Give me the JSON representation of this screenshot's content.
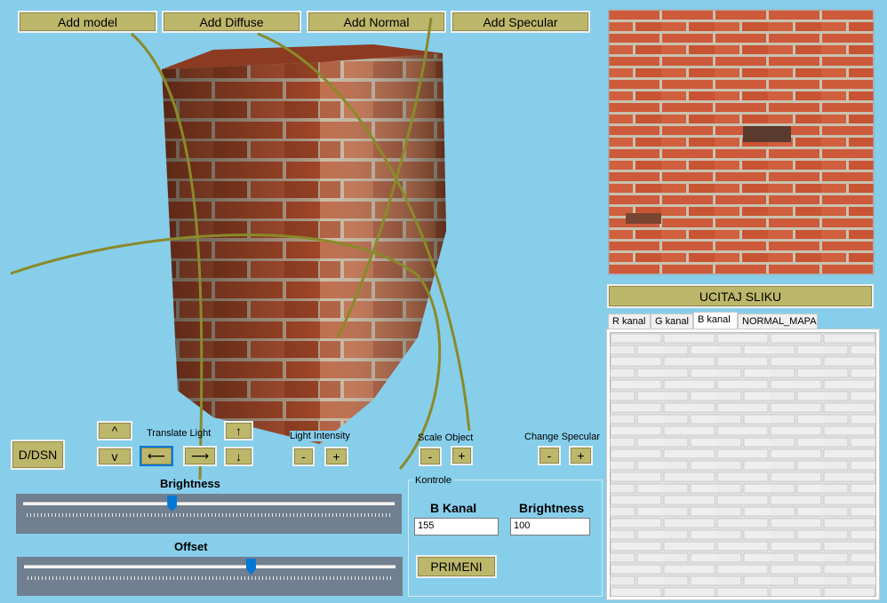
{
  "toolbar": {
    "add_model": "Add model",
    "add_diffuse": "Add Diffuse",
    "add_normal": "Add Normal",
    "add_specular": "Add Specular"
  },
  "controls": {
    "dds_button": "D/DSN",
    "translate_label": "Translate Light",
    "up_caret": "^",
    "down_caret": "v",
    "arrow_left": "⟵",
    "arrow_right": "⟶",
    "arrow_up": "↑",
    "arrow_down": "↓",
    "light_intensity_label": "Light Intensity",
    "scale_object_label": "Scale Object",
    "change_specular_label": "Change Specular",
    "minus": "-",
    "plus": "+"
  },
  "sliders": {
    "brightness_label": "Brightness",
    "brightness_value": 0.4,
    "offset_label": "Offset",
    "offset_value": 0.61
  },
  "kontrole": {
    "group_label": "Kontrole",
    "b_kanal_label": "B Kanal",
    "brightness_label": "Brightness",
    "b_kanal_value": "155",
    "brightness_value": "100",
    "apply_button": "PRIMENI"
  },
  "right_panel": {
    "load_button": "UCITAJ SLIKU",
    "tabs": [
      "R kanal",
      "G kanal",
      "B kanal",
      "NORMAL_MAPA"
    ],
    "active_tab": "B kanal"
  },
  "colors": {
    "background": "#87ceeb",
    "button": "#bdb76b",
    "slider_panel": "#708090",
    "thumb": "#0078d7"
  }
}
